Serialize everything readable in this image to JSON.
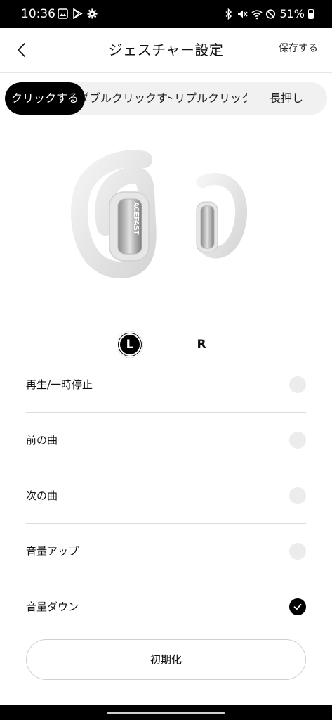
{
  "status_bar": {
    "time": "10:36",
    "battery": "51%",
    "left_icons": [
      "image-icon",
      "play-store-icon",
      "settings-icon"
    ],
    "right_icons": [
      "bluetooth-icon",
      "mute-icon",
      "wifi-icon",
      "do-not-disturb-icon",
      "battery-icon"
    ]
  },
  "header": {
    "title": "ジェスチャー設定",
    "save_label": "保存する"
  },
  "tabs": [
    {
      "label": "クリックする",
      "active": true
    },
    {
      "label": "ダブルクリックする",
      "active": false
    },
    {
      "label": "トリプルクリックする",
      "active": false
    },
    {
      "label": "長押し",
      "active": false
    }
  ],
  "product": {
    "brand_text": "ACEFAST",
    "color": "#e9e9e9"
  },
  "sides": {
    "left": "L",
    "right": "R",
    "selected": "L"
  },
  "options": [
    {
      "label": "再生/一時停止",
      "checked": false
    },
    {
      "label": "前の曲",
      "checked": false
    },
    {
      "label": "次の曲",
      "checked": false
    },
    {
      "label": "音量アップ",
      "checked": false
    },
    {
      "label": "音量ダウン",
      "checked": true
    }
  ],
  "reset_label": "初期化",
  "colors": {
    "accent": "#000000",
    "unchecked": "#ececec",
    "divider": "#dcdcdc",
    "background": "#ffffff"
  }
}
